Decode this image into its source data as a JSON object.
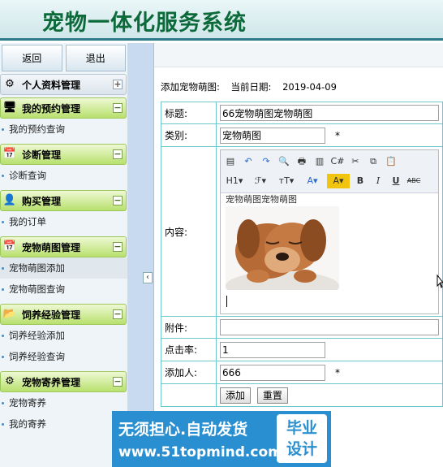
{
  "header": {
    "title": "宠物一体化服务系统"
  },
  "sidebar": {
    "top_buttons": [
      "返回",
      "退出"
    ],
    "groups": [
      {
        "title": "个人资料管理",
        "icon": "gear-icon",
        "style": "plain",
        "toggle": "+",
        "items": []
      },
      {
        "title": "我的预约管理",
        "icon": "monitor-icon",
        "style": "green",
        "toggle": "−",
        "items": [
          "我的预约查询"
        ]
      },
      {
        "title": "诊断管理",
        "icon": "calendar-icon",
        "style": "green",
        "toggle": "−",
        "items": [
          "诊断查询"
        ]
      },
      {
        "title": "购买管理",
        "icon": "user-icon",
        "style": "green",
        "toggle": "−",
        "items": [
          "我的订单"
        ]
      },
      {
        "title": "宠物萌图管理",
        "icon": "calendar-icon",
        "style": "green",
        "toggle": "−",
        "items": [
          "宠物萌图添加",
          "宠物萌图查询"
        ]
      },
      {
        "title": "饲养经验管理",
        "icon": "folder-icon",
        "style": "green",
        "toggle": "−",
        "items": [
          "饲养经验添加",
          "饲养经验查询"
        ]
      },
      {
        "title": "宠物寄养管理",
        "icon": "gear-icon",
        "style": "green",
        "toggle": "−",
        "items": [
          "宠物寄养",
          "我的寄养"
        ]
      }
    ]
  },
  "content": {
    "page_label": "添加宠物萌图:",
    "date_label": "当前日期:",
    "date_value": "2019-04-09",
    "form": {
      "title_label": "标题:",
      "title_value": "66宠物萌图宠物萌图",
      "category_label": "类别:",
      "category_value": "宠物萌图",
      "required_mark": "*",
      "content_label": "内容:",
      "editor_text": "宠物萌图宠物萌图",
      "toolbar_row1": [
        "source-icon",
        "undo-icon",
        "redo-icon",
        "preview-icon",
        "print-icon",
        "template-icon",
        "code-icon",
        "cut-icon",
        "copy-icon",
        "paste-icon"
      ],
      "toolbar_row2": [
        "H1▾",
        "ℱ▾",
        "ᴛT▾",
        "A▾",
        "A▾",
        "B",
        "I",
        "U",
        "ABC"
      ],
      "attachment_label": "附件:",
      "clicks_label": "点击率:",
      "clicks_value": "1",
      "adder_label": "添加人:",
      "adder_value": "666",
      "submit_label": "添加",
      "reset_label": "重置"
    }
  },
  "watermark": {
    "line1": "无须担心.自动发货",
    "line2": "www.51topmind.com",
    "badge_line1": "毕业",
    "badge_line2": "设计"
  },
  "colors": {
    "title": "#0c6a3a",
    "menu_green": "#b8e06e",
    "table_border": "#6cc8cf",
    "watermark": "#2a8fd0"
  }
}
